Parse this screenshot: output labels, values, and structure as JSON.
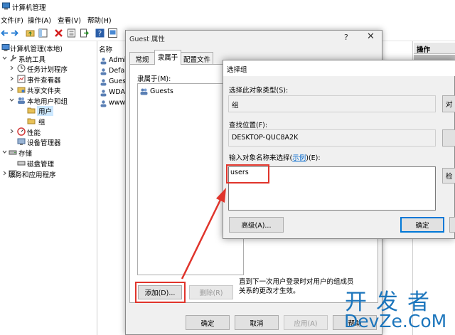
{
  "window": {
    "title": "计算机管理"
  },
  "menu": [
    {
      "label": "文件(F)"
    },
    {
      "label": "操作(A)"
    },
    {
      "label": "查看(V)"
    },
    {
      "label": "帮助(H)"
    }
  ],
  "tree": [
    {
      "label": "计算机管理(本地)",
      "icon": "computer-icon"
    },
    {
      "label": "系统工具",
      "icon": "tools-icon"
    },
    {
      "label": "任务计划程序",
      "icon": "clock-icon"
    },
    {
      "label": "事件查看器",
      "icon": "event-viewer-icon"
    },
    {
      "label": "共享文件夹",
      "icon": "shared-folder-icon"
    },
    {
      "label": "本地用户和组",
      "icon": "users-icon"
    },
    {
      "label": "用户",
      "icon": "folder-icon"
    },
    {
      "label": "组",
      "icon": "folder-icon"
    },
    {
      "label": "性能",
      "icon": "performance-icon"
    },
    {
      "label": "设备管理器",
      "icon": "device-manager-icon"
    },
    {
      "label": "存储",
      "icon": "storage-icon"
    },
    {
      "label": "磁盘管理",
      "icon": "disk-icon"
    },
    {
      "label": "服务和应用程序",
      "icon": "services-icon"
    }
  ],
  "list": {
    "header": "名称",
    "rows": [
      {
        "label": "Admi"
      },
      {
        "label": "Defa"
      },
      {
        "label": "Gues"
      },
      {
        "label": "WDA"
      },
      {
        "label": "www."
      }
    ]
  },
  "actions": {
    "header": "操作"
  },
  "guest_dialog": {
    "title": "Guest 属性",
    "help": "?",
    "close": "✕",
    "tabs": [
      {
        "label": "常规"
      },
      {
        "label": "隶属于"
      },
      {
        "label": "配置文件"
      }
    ],
    "member_of_label": "隶属于(M):",
    "member_item": "Guests",
    "add_button": "添加(D)...",
    "remove_button": "删除(R)",
    "note": "直到下一次用户登录时对用户的组成员关系的更改才生效。",
    "ok_button": "确定",
    "cancel_button": "取消",
    "apply_button": "应用(A)",
    "help_button": "帮助"
  },
  "select_dialog": {
    "title": "选择组",
    "object_type_label": "选择此对象类型(S):",
    "object_type_value": "组",
    "object_type_button": "对",
    "location_label": "查找位置(F):",
    "location_value": "DESKTOP-QUC8A2K",
    "enter_label_prefix": "输入对象名称来选择(",
    "enter_label_link": "示例",
    "enter_label_suffix": ")(E):",
    "object_name_value": "users",
    "check_button": "检",
    "advanced_button": "高级(A)...",
    "ok_button": "确定"
  },
  "watermark": {
    "cn": "开发者",
    "en": "DevZe.CoM"
  },
  "colors": {
    "highlight": "#e0342b",
    "selection": "#cce8ff",
    "link": "#0066cc",
    "watermark": "#1b75bc"
  }
}
